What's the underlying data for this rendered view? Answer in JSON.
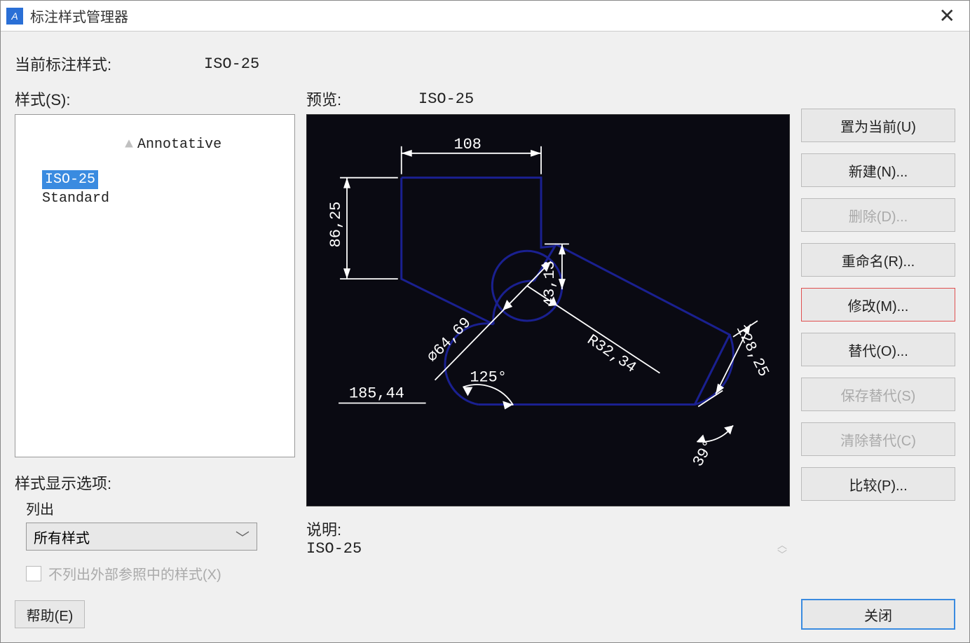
{
  "window": {
    "title": "标注样式管理器"
  },
  "current": {
    "label": "当前标注样式:",
    "value": "ISO-25"
  },
  "styles": {
    "label": "样式(S):",
    "items": [
      {
        "text": "Annotative",
        "annotative": true,
        "selected": false
      },
      {
        "text": "ISO-25",
        "annotative": false,
        "selected": true,
        "indent": true
      },
      {
        "text": "Standard",
        "annotative": false,
        "selected": false,
        "indent": true
      }
    ]
  },
  "preview": {
    "label": "预览:",
    "name": "ISO-25",
    "dims": {
      "top": "108",
      "leftv": "86,25",
      "inner": "43,13",
      "dia": "⌀64,69",
      "angle": "125°",
      "bottom": "185,44",
      "radius": "R32,34",
      "diag": "128,25",
      "arc": "39°"
    }
  },
  "description": {
    "label": "说明:",
    "text": "ISO-25"
  },
  "displayOptions": {
    "label": "样式显示选项:",
    "listLabel": "列出",
    "comboValue": "所有样式",
    "checkboxLabel": "不列出外部参照中的样式(X)"
  },
  "buttons": {
    "setCurrent": "置为当前(U)",
    "new": "新建(N)...",
    "delete": "删除(D)...",
    "rename": "重命名(R)...",
    "modify": "修改(M)...",
    "override": "替代(O)...",
    "saveOverride": "保存替代(S)",
    "clearOverride": "清除替代(C)",
    "compare": "比较(P)...",
    "help": "帮助(E)",
    "close": "关闭"
  }
}
